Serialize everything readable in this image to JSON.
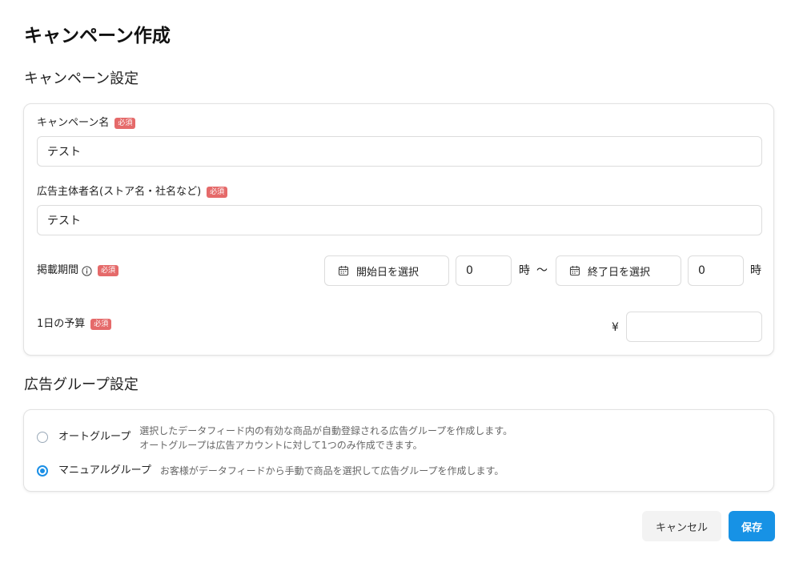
{
  "page_title": "キャンペーン作成",
  "campaign_section": {
    "title": "キャンペーン設定",
    "required_badge": "必須",
    "campaign_name": {
      "label": "キャンペーン名",
      "value": "テスト"
    },
    "advertiser_name": {
      "label": "広告主体者名(ストア名・社名など)",
      "value": "テスト"
    },
    "period": {
      "label": "掲載期間",
      "info_icon": "info-icon",
      "start_date_label": "開始日を選択",
      "start_hour": "0",
      "hour_unit": "時",
      "separator": "〜",
      "end_date_label": "終了日を選択",
      "end_hour": "0",
      "calendar_icon": "calendar-icon"
    },
    "daily_budget": {
      "label": "1日の予算",
      "currency": "¥",
      "value": ""
    }
  },
  "ad_group_section": {
    "title": "広告グループ設定",
    "options": [
      {
        "label": "オートグループ",
        "description_line1": "選択したデータフィード内の有効な商品が自動登録される広告グループを作成します。",
        "description_line2": "オートグループは広告アカウントに対して1つのみ作成できます。",
        "selected": false
      },
      {
        "label": "マニュアルグループ",
        "description_line1": "お客様がデータフィードから手動で商品を選択して広告グループを作成します。",
        "selected": true
      }
    ]
  },
  "actions": {
    "cancel_label": "キャンセル",
    "save_label": "保存"
  },
  "colors": {
    "accent": "#1792e5",
    "required_badge": "#e56a6a",
    "border": "#dcdcdc"
  }
}
